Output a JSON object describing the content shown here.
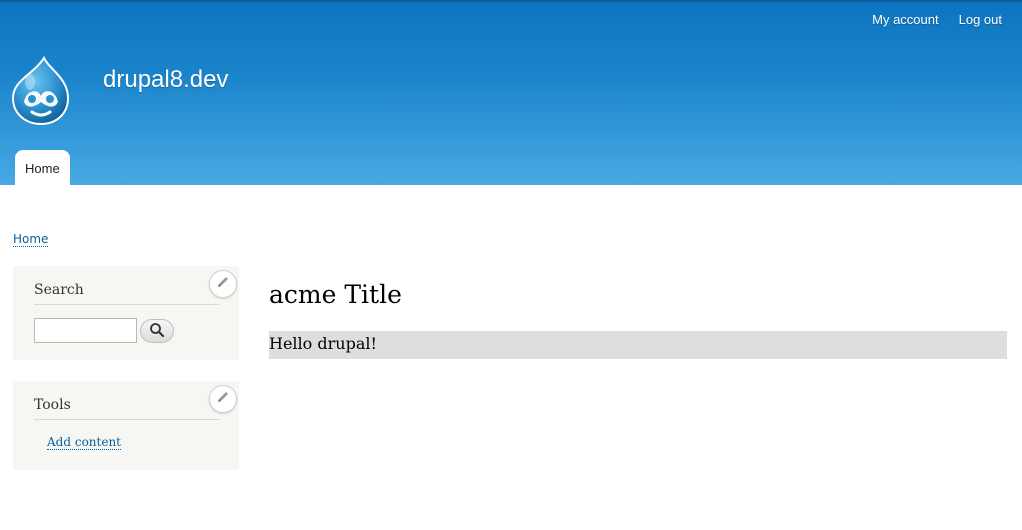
{
  "header": {
    "secondary_menu": [
      {
        "label": "My account"
      },
      {
        "label": "Log out"
      }
    ],
    "site_name": "drupal8.dev",
    "logo_icon": "drupal-drop-logo",
    "main_menu": [
      {
        "label": "Home"
      }
    ],
    "colors": {
      "header_top": "#0d75bf",
      "header_bottom": "#48a9e3",
      "link": "#0a5e9a"
    }
  },
  "breadcrumb": {
    "items": [
      {
        "label": "Home"
      }
    ]
  },
  "sidebar": {
    "search_block": {
      "title": "Search",
      "input_value": "",
      "search_icon": "magnifier-icon",
      "edit_icon": "pencil-icon"
    },
    "tools_block": {
      "title": "Tools",
      "links": [
        {
          "label": "Add content"
        }
      ],
      "edit_icon": "pencil-icon"
    }
  },
  "main": {
    "title": "acme Title",
    "body": "Hello drupal!"
  }
}
